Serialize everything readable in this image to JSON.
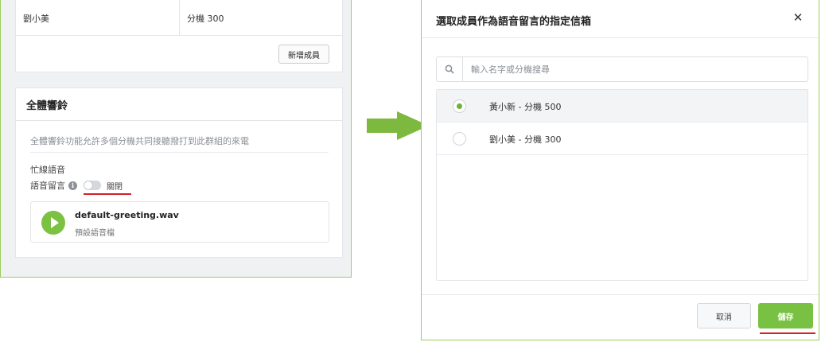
{
  "left_panel": {
    "member_row": {
      "name": "劉小美",
      "extension": "分機 300"
    },
    "add_member_label": "新增成員",
    "ring_group": {
      "title": "全體響鈴",
      "description": "全體響鈴功能允許多個分機共同接聽撥打到此群組的來電",
      "busy_label": "忙線語音",
      "voicemail_label": "語音留言",
      "voicemail_state": "關閉",
      "voicemail_enabled": false,
      "audio": {
        "filename": "default-greeting.wav",
        "subtitle": "預設語音檔"
      }
    }
  },
  "modal": {
    "title": "選取成員作為語音留言的指定信箱",
    "close_glyph": "✕",
    "search": {
      "placeholder": "輸入名字或分機搜尋",
      "value": ""
    },
    "options": [
      {
        "label": "黃小新 - 分機 500",
        "selected": true
      },
      {
        "label": "劉小美 - 分機 300",
        "selected": false
      }
    ],
    "cancel_label": "取消",
    "save_label": "儲存"
  },
  "colors": {
    "accent_green": "#79c142",
    "frame_border": "#9bcf5a",
    "highlight_red": "#d21f2a"
  },
  "icons": [
    "info-icon",
    "play-icon",
    "search-icon",
    "close-icon",
    "arrow-right-icon"
  ]
}
